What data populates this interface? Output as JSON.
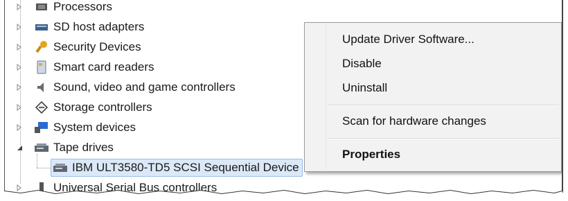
{
  "tree": {
    "items": [
      {
        "label": "Processors",
        "icon": "processor-icon",
        "expanded": false
      },
      {
        "label": "SD host adapters",
        "icon": "sd-adapter-icon",
        "expanded": false
      },
      {
        "label": "Security Devices",
        "icon": "key-icon",
        "expanded": false
      },
      {
        "label": "Smart card readers",
        "icon": "smart-card-icon",
        "expanded": false
      },
      {
        "label": "Sound, video and game controllers",
        "icon": "speaker-icon",
        "expanded": false
      },
      {
        "label": "Storage controllers",
        "icon": "storage-controller-icon",
        "expanded": false
      },
      {
        "label": "System devices",
        "icon": "system-device-icon",
        "expanded": false
      },
      {
        "label": "Tape drives",
        "icon": "tape-drive-icon",
        "expanded": true
      },
      {
        "label": "IBM ULT3580-TD5 SCSI Sequential Device",
        "icon": "tape-drive-icon",
        "selected": true
      },
      {
        "label": "Universal Serial Bus controllers",
        "icon": "usb-icon",
        "expanded": false
      }
    ]
  },
  "context_menu": {
    "items": [
      {
        "label": "Update Driver Software..."
      },
      {
        "label": "Disable"
      },
      {
        "label": "Uninstall"
      },
      {
        "label": "Scan for hardware changes"
      },
      {
        "label": "Properties",
        "bold": true
      }
    ]
  },
  "colors": {
    "selection_bg": "#dbe8f7",
    "selection_border": "#9bbde6",
    "menu_bg": "#f2f2f2"
  }
}
